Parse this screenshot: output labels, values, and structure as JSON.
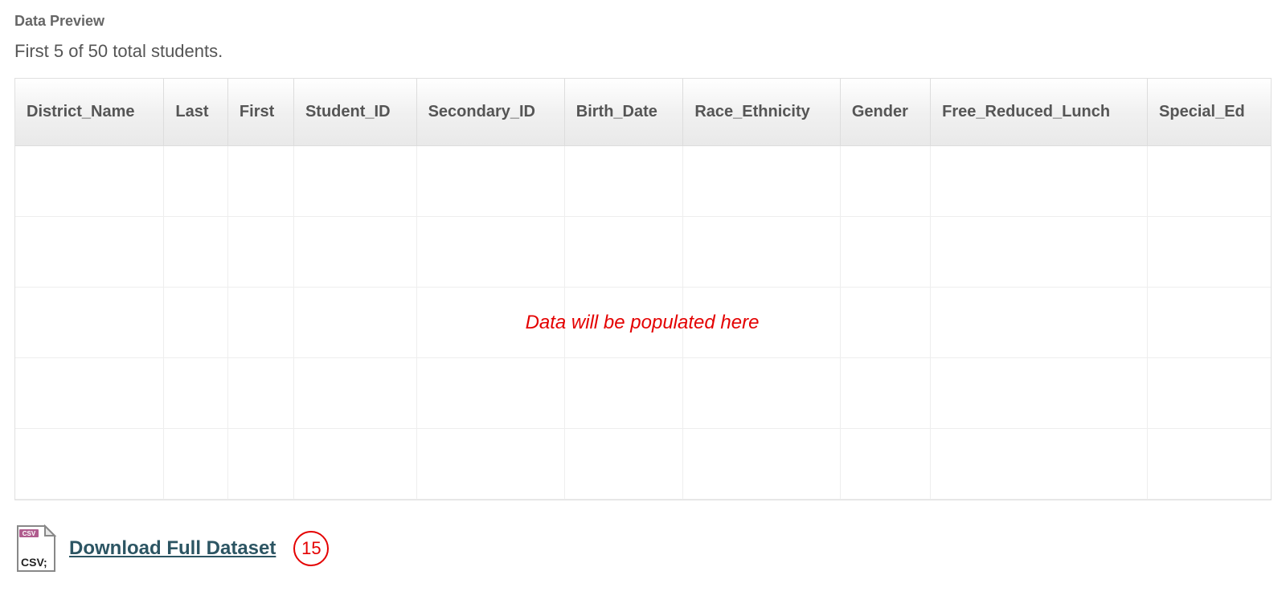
{
  "section_title": "Data Preview",
  "summary": "First 5 of 50 total students.",
  "table": {
    "headers": [
      "District_Name",
      "Last",
      "First",
      "Student_ID",
      "Secondary_ID",
      "Birth_Date",
      "Race_Ethnicity",
      "Gender",
      "Free_Reduced_Lunch",
      "Special_Ed"
    ],
    "placeholder_text": "Data will be populated here"
  },
  "download": {
    "label": "Download Full Dataset",
    "callout_number": "15",
    "icon_top_label": "CSV",
    "icon_bottom_label": "CSV;"
  }
}
